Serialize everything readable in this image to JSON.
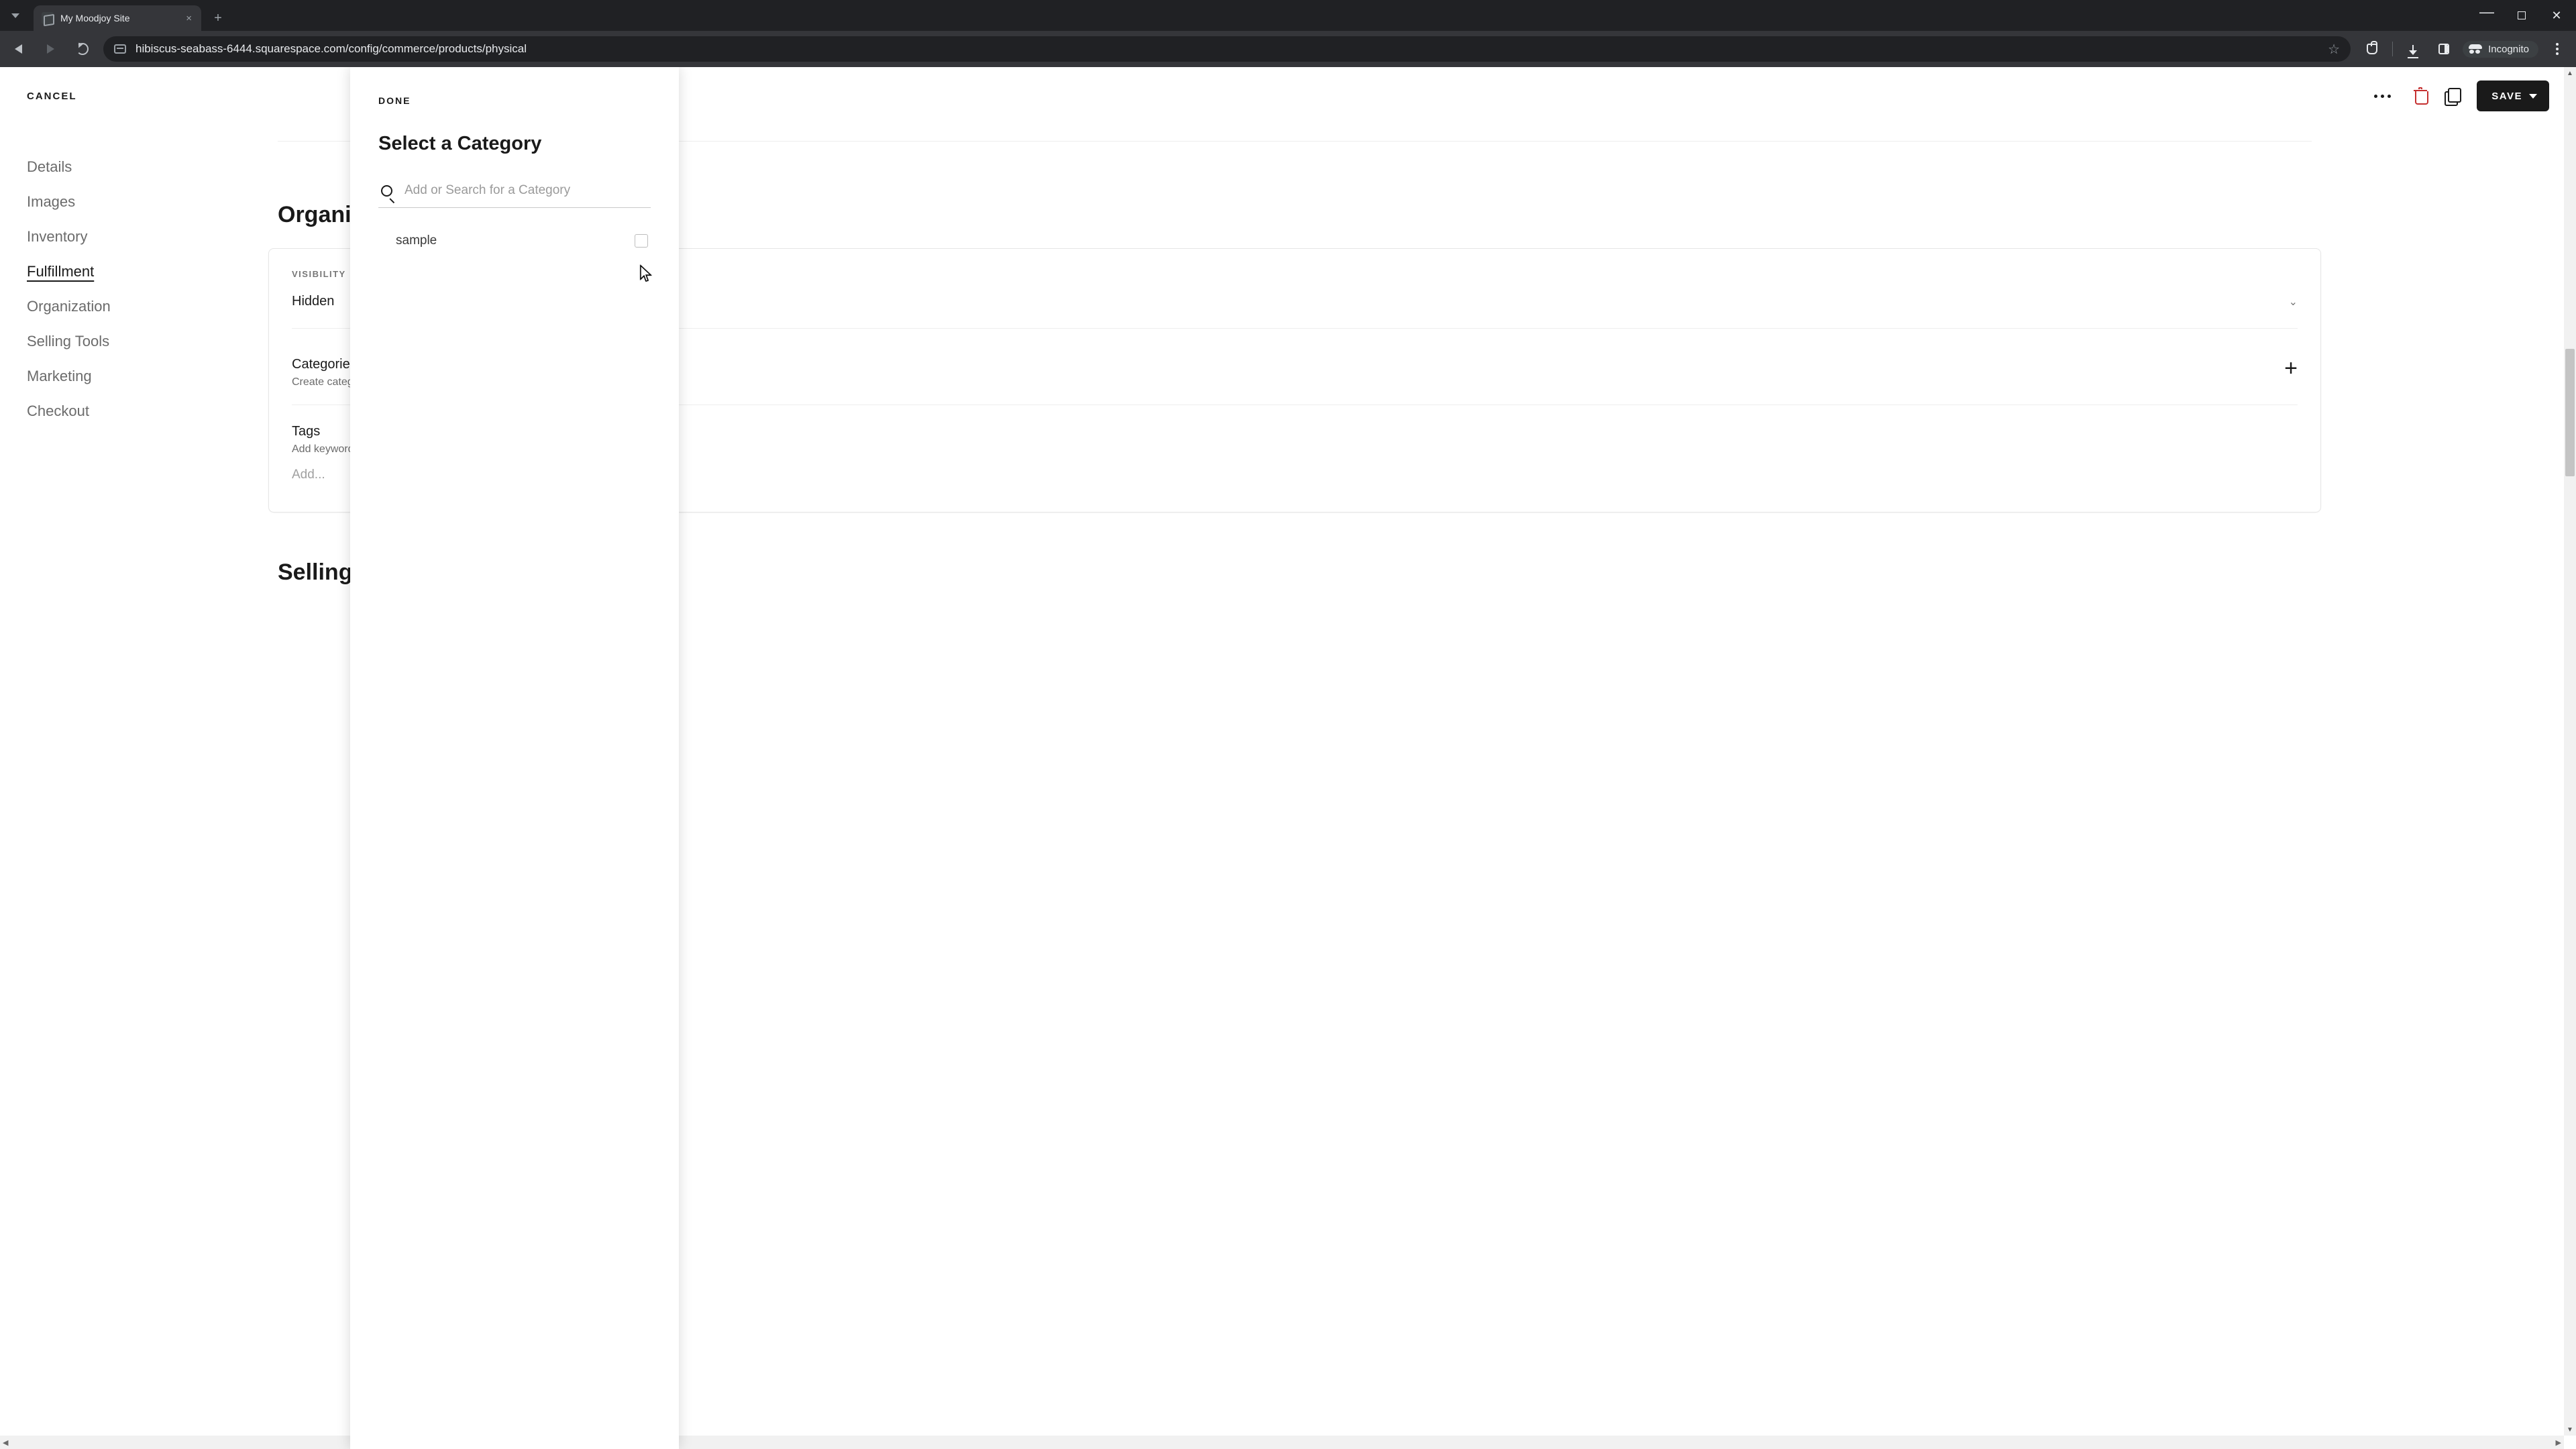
{
  "browser": {
    "tab_title": "My Moodjoy Site",
    "url": "hibiscus-seabass-6444.squarespace.com/config/commerce/products/physical",
    "incognito_label": "Incognito"
  },
  "appbar": {
    "cancel": "CANCEL",
    "save": "SAVE"
  },
  "sidenav": {
    "items": [
      {
        "label": "Details"
      },
      {
        "label": "Images"
      },
      {
        "label": "Inventory"
      },
      {
        "label": "Fulfillment",
        "active": true
      },
      {
        "label": "Organization"
      },
      {
        "label": "Selling Tools"
      },
      {
        "label": "Marketing"
      },
      {
        "label": "Checkout"
      }
    ]
  },
  "main": {
    "section_org_title": "Organization",
    "visibility_label": "VISIBILITY",
    "visibility_value": "Hidden",
    "categories_title": "Categories",
    "categories_sub": "Create categories to organize products for display and navigation.",
    "tags_title": "Tags",
    "tags_sub": "Add keywords to help customers find this product.",
    "tags_add_placeholder": "Add...",
    "section_selling_title": "Selling Tools"
  },
  "modal": {
    "done": "DONE",
    "title": "Select a Category",
    "search_placeholder": "Add or Search for a Category",
    "categories": [
      {
        "name": "sample",
        "checked": false
      }
    ]
  }
}
